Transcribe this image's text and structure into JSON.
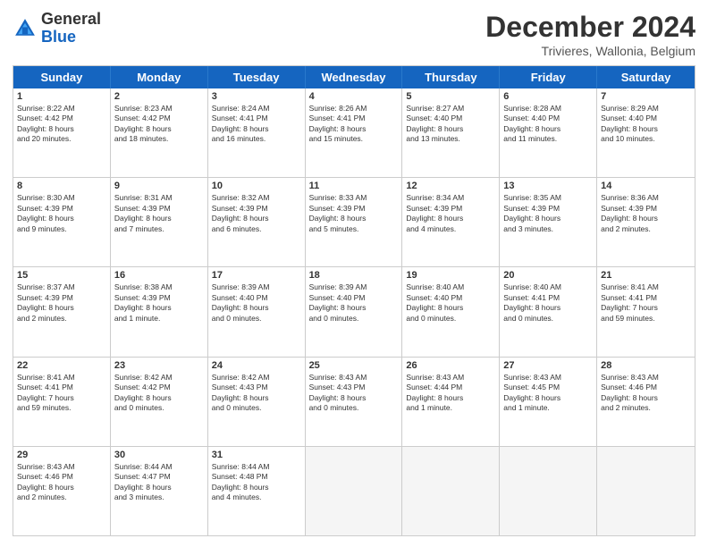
{
  "header": {
    "logo_general": "General",
    "logo_blue": "Blue",
    "month_title": "December 2024",
    "subtitle": "Trivieres, Wallonia, Belgium"
  },
  "days_of_week": [
    "Sunday",
    "Monday",
    "Tuesday",
    "Wednesday",
    "Thursday",
    "Friday",
    "Saturday"
  ],
  "rows": [
    [
      {
        "day": "1",
        "lines": [
          "Sunrise: 8:22 AM",
          "Sunset: 4:42 PM",
          "Daylight: 8 hours",
          "and 20 minutes."
        ]
      },
      {
        "day": "2",
        "lines": [
          "Sunrise: 8:23 AM",
          "Sunset: 4:42 PM",
          "Daylight: 8 hours",
          "and 18 minutes."
        ]
      },
      {
        "day": "3",
        "lines": [
          "Sunrise: 8:24 AM",
          "Sunset: 4:41 PM",
          "Daylight: 8 hours",
          "and 16 minutes."
        ]
      },
      {
        "day": "4",
        "lines": [
          "Sunrise: 8:26 AM",
          "Sunset: 4:41 PM",
          "Daylight: 8 hours",
          "and 15 minutes."
        ]
      },
      {
        "day": "5",
        "lines": [
          "Sunrise: 8:27 AM",
          "Sunset: 4:40 PM",
          "Daylight: 8 hours",
          "and 13 minutes."
        ]
      },
      {
        "day": "6",
        "lines": [
          "Sunrise: 8:28 AM",
          "Sunset: 4:40 PM",
          "Daylight: 8 hours",
          "and 11 minutes."
        ]
      },
      {
        "day": "7",
        "lines": [
          "Sunrise: 8:29 AM",
          "Sunset: 4:40 PM",
          "Daylight: 8 hours",
          "and 10 minutes."
        ]
      }
    ],
    [
      {
        "day": "8",
        "lines": [
          "Sunrise: 8:30 AM",
          "Sunset: 4:39 PM",
          "Daylight: 8 hours",
          "and 9 minutes."
        ]
      },
      {
        "day": "9",
        "lines": [
          "Sunrise: 8:31 AM",
          "Sunset: 4:39 PM",
          "Daylight: 8 hours",
          "and 7 minutes."
        ]
      },
      {
        "day": "10",
        "lines": [
          "Sunrise: 8:32 AM",
          "Sunset: 4:39 PM",
          "Daylight: 8 hours",
          "and 6 minutes."
        ]
      },
      {
        "day": "11",
        "lines": [
          "Sunrise: 8:33 AM",
          "Sunset: 4:39 PM",
          "Daylight: 8 hours",
          "and 5 minutes."
        ]
      },
      {
        "day": "12",
        "lines": [
          "Sunrise: 8:34 AM",
          "Sunset: 4:39 PM",
          "Daylight: 8 hours",
          "and 4 minutes."
        ]
      },
      {
        "day": "13",
        "lines": [
          "Sunrise: 8:35 AM",
          "Sunset: 4:39 PM",
          "Daylight: 8 hours",
          "and 3 minutes."
        ]
      },
      {
        "day": "14",
        "lines": [
          "Sunrise: 8:36 AM",
          "Sunset: 4:39 PM",
          "Daylight: 8 hours",
          "and 2 minutes."
        ]
      }
    ],
    [
      {
        "day": "15",
        "lines": [
          "Sunrise: 8:37 AM",
          "Sunset: 4:39 PM",
          "Daylight: 8 hours",
          "and 2 minutes."
        ]
      },
      {
        "day": "16",
        "lines": [
          "Sunrise: 8:38 AM",
          "Sunset: 4:39 PM",
          "Daylight: 8 hours",
          "and 1 minute."
        ]
      },
      {
        "day": "17",
        "lines": [
          "Sunrise: 8:39 AM",
          "Sunset: 4:40 PM",
          "Daylight: 8 hours",
          "and 0 minutes."
        ]
      },
      {
        "day": "18",
        "lines": [
          "Sunrise: 8:39 AM",
          "Sunset: 4:40 PM",
          "Daylight: 8 hours",
          "and 0 minutes."
        ]
      },
      {
        "day": "19",
        "lines": [
          "Sunrise: 8:40 AM",
          "Sunset: 4:40 PM",
          "Daylight: 8 hours",
          "and 0 minutes."
        ]
      },
      {
        "day": "20",
        "lines": [
          "Sunrise: 8:40 AM",
          "Sunset: 4:41 PM",
          "Daylight: 8 hours",
          "and 0 minutes."
        ]
      },
      {
        "day": "21",
        "lines": [
          "Sunrise: 8:41 AM",
          "Sunset: 4:41 PM",
          "Daylight: 7 hours",
          "and 59 minutes."
        ]
      }
    ],
    [
      {
        "day": "22",
        "lines": [
          "Sunrise: 8:41 AM",
          "Sunset: 4:41 PM",
          "Daylight: 7 hours",
          "and 59 minutes."
        ]
      },
      {
        "day": "23",
        "lines": [
          "Sunrise: 8:42 AM",
          "Sunset: 4:42 PM",
          "Daylight: 8 hours",
          "and 0 minutes."
        ]
      },
      {
        "day": "24",
        "lines": [
          "Sunrise: 8:42 AM",
          "Sunset: 4:43 PM",
          "Daylight: 8 hours",
          "and 0 minutes."
        ]
      },
      {
        "day": "25",
        "lines": [
          "Sunrise: 8:43 AM",
          "Sunset: 4:43 PM",
          "Daylight: 8 hours",
          "and 0 minutes."
        ]
      },
      {
        "day": "26",
        "lines": [
          "Sunrise: 8:43 AM",
          "Sunset: 4:44 PM",
          "Daylight: 8 hours",
          "and 1 minute."
        ]
      },
      {
        "day": "27",
        "lines": [
          "Sunrise: 8:43 AM",
          "Sunset: 4:45 PM",
          "Daylight: 8 hours",
          "and 1 minute."
        ]
      },
      {
        "day": "28",
        "lines": [
          "Sunrise: 8:43 AM",
          "Sunset: 4:46 PM",
          "Daylight: 8 hours",
          "and 2 minutes."
        ]
      }
    ],
    [
      {
        "day": "29",
        "lines": [
          "Sunrise: 8:43 AM",
          "Sunset: 4:46 PM",
          "Daylight: 8 hours",
          "and 2 minutes."
        ]
      },
      {
        "day": "30",
        "lines": [
          "Sunrise: 8:44 AM",
          "Sunset: 4:47 PM",
          "Daylight: 8 hours",
          "and 3 minutes."
        ]
      },
      {
        "day": "31",
        "lines": [
          "Sunrise: 8:44 AM",
          "Sunset: 4:48 PM",
          "Daylight: 8 hours",
          "and 4 minutes."
        ]
      },
      {
        "day": "",
        "lines": []
      },
      {
        "day": "",
        "lines": []
      },
      {
        "day": "",
        "lines": []
      },
      {
        "day": "",
        "lines": []
      }
    ]
  ]
}
